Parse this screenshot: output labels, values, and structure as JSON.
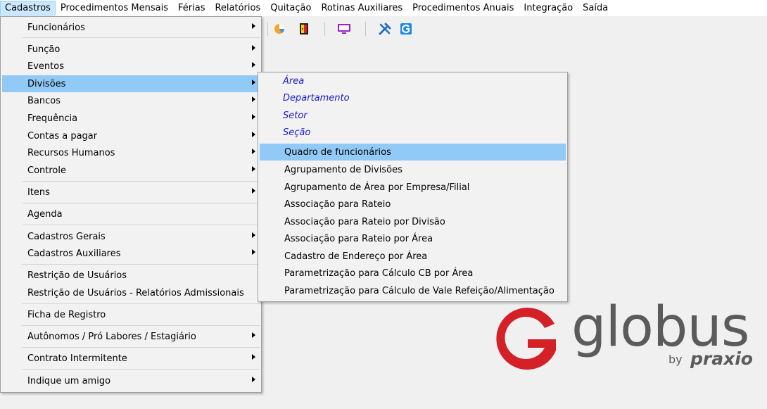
{
  "menubar": {
    "items": [
      {
        "label": "Cadastros"
      },
      {
        "label": "Procedimentos Mensais"
      },
      {
        "label": "Férias"
      },
      {
        "label": "Relatórios"
      },
      {
        "label": "Quitação"
      },
      {
        "label": "Rotinas Auxiliares"
      },
      {
        "label": "Procedimentos Anuais"
      },
      {
        "label": "Integração"
      },
      {
        "label": "Saída"
      }
    ]
  },
  "toolbar": {
    "icons": [
      "pie-chart-icon",
      "door-exit-icon",
      "monitor-icon",
      "tools-icon",
      "globus-app-icon"
    ]
  },
  "cadastros_menu": {
    "items": [
      {
        "label": "Funcionários",
        "has_submenu": true
      },
      {
        "label": "Função",
        "has_submenu": true
      },
      {
        "label": "Eventos",
        "has_submenu": true
      },
      {
        "label": "Divisões",
        "has_submenu": true,
        "highlighted": true
      },
      {
        "label": "Bancos",
        "has_submenu": true
      },
      {
        "label": "Frequência",
        "has_submenu": true
      },
      {
        "label": "Contas a pagar",
        "has_submenu": true
      },
      {
        "label": "Recursos Humanos",
        "has_submenu": true
      },
      {
        "label": "Controle",
        "has_submenu": true
      },
      {
        "label": "Itens",
        "has_submenu": true
      },
      {
        "label": "Agenda",
        "has_submenu": false
      },
      {
        "label": "Cadastros Gerais",
        "has_submenu": true
      },
      {
        "label": "Cadastros Auxiliares",
        "has_submenu": true
      },
      {
        "label": "Restrição de Usuários",
        "has_submenu": false
      },
      {
        "label": "Restrição de Usuários - Relatórios Admissionais",
        "has_submenu": false
      },
      {
        "label": "Ficha de Registro",
        "has_submenu": false
      },
      {
        "label": "Autônomos / Pró Labores / Estagiário",
        "has_submenu": true
      },
      {
        "label": "Contrato Intermitente",
        "has_submenu": true
      },
      {
        "label": "Indique um amigo",
        "has_submenu": true
      }
    ]
  },
  "divisoes_submenu": {
    "items": [
      {
        "label": "Área",
        "style": "italic-blue"
      },
      {
        "label": "Departamento",
        "style": "italic-blue"
      },
      {
        "label": "Setor",
        "style": "italic-blue"
      },
      {
        "label": "Seção",
        "style": "italic-blue"
      },
      {
        "label": "Quadro de funcionários",
        "highlighted": true
      },
      {
        "label": "Agrupamento de Divisões"
      },
      {
        "label": "Agrupamento de Área por Empresa/Filial"
      },
      {
        "label": "Associação para Rateio"
      },
      {
        "label": "Associação para Rateio por Divisão"
      },
      {
        "label": "Associação para Rateio por Área"
      },
      {
        "label": "Cadastro de Endereço por Área"
      },
      {
        "label": "Parametrização para Cálculo CB por Área"
      },
      {
        "label": "Parametrização para Cálculo de Vale Refeição/Alimentação"
      }
    ]
  },
  "logo": {
    "word": "globus",
    "by": "by",
    "brand": "praxio",
    "colors": {
      "red": "#d42027",
      "gray": "#5b5b5b"
    }
  },
  "colors": {
    "menu_highlight": "#91c9f7",
    "menubar_active": "#cce8ff",
    "submenu_italic_text": "#1a1ac8"
  }
}
